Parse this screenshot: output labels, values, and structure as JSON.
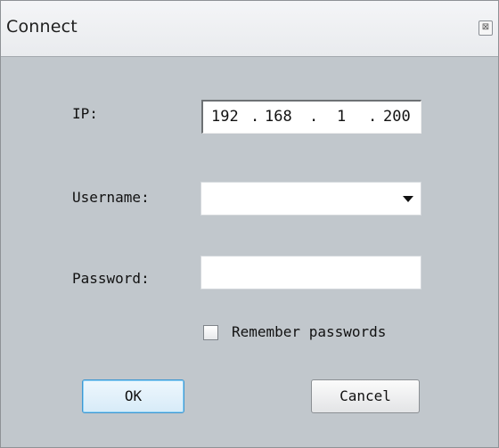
{
  "window": {
    "title": "Connect",
    "close_glyph": "⊠"
  },
  "form": {
    "ip_label": "IP:",
    "ip_value": [
      "192",
      "168",
      "1",
      "200"
    ],
    "ip_separator": ".",
    "username_label": "Username:",
    "username_value": "",
    "password_label": "Password:",
    "password_value": "",
    "remember_label": "Remember passwords",
    "remember_checked": false
  },
  "buttons": {
    "ok_label": "OK",
    "cancel_label": "Cancel"
  },
  "colors": {
    "dialog_bg": "#c1c7cc",
    "default_button_border": "#3e97d1"
  }
}
